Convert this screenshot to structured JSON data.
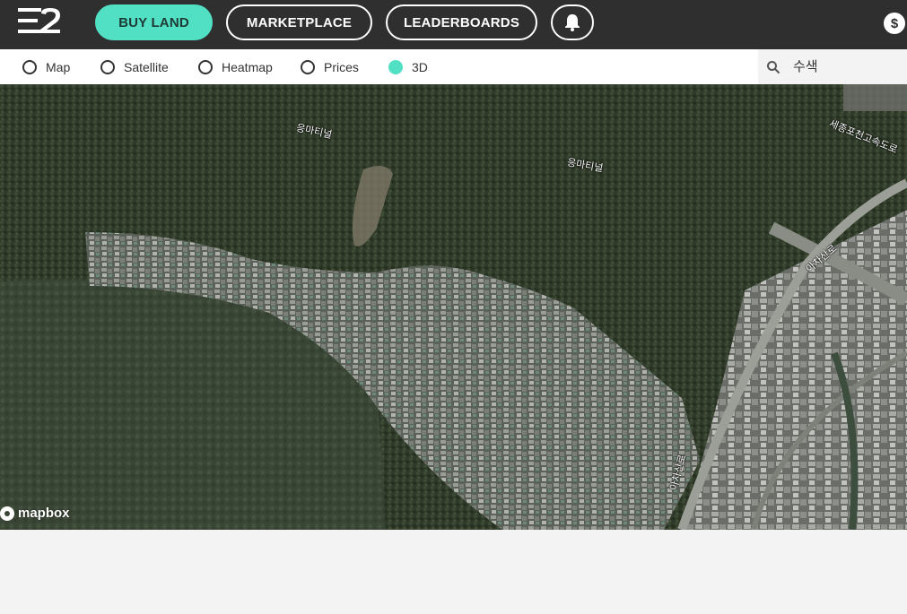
{
  "nav": {
    "buy_land": "BUY LAND",
    "marketplace": "MARKETPLACE",
    "leaderboards": "LEADERBOARDS",
    "bell_icon": "bell-icon",
    "currency_symbol": "$"
  },
  "map_options": {
    "items": [
      {
        "label": "Map",
        "selected": false
      },
      {
        "label": "Satellite",
        "selected": false
      },
      {
        "label": "Heatmap",
        "selected": false
      },
      {
        "label": "Prices",
        "selected": false
      },
      {
        "label": "3D",
        "selected": true
      }
    ],
    "accent_color": "#52e0c4"
  },
  "search": {
    "placeholder": "수색"
  },
  "map": {
    "labels": [
      "응마티널",
      "응마티널",
      "세종포천고속도로",
      "아차산로",
      "아차산로"
    ],
    "attribution": "mapbox"
  },
  "colors": {
    "topbar": "#2f2f2f",
    "accent": "#52e0c4",
    "page_background": "#f3f3f3"
  }
}
